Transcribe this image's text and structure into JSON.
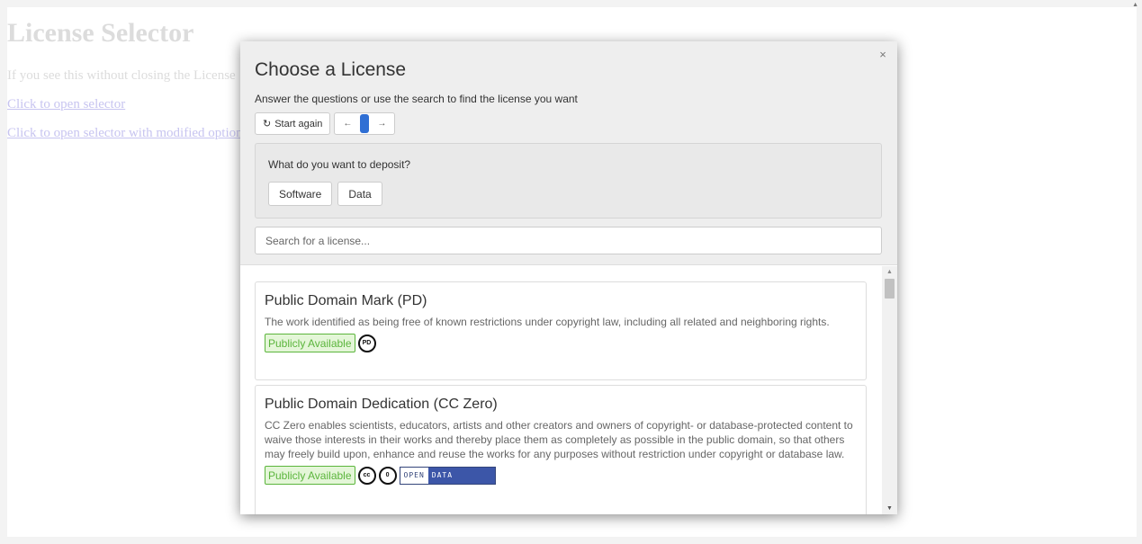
{
  "background": {
    "title": "License Selector",
    "text": "If you see this without closing the License",
    "link1": "Click to open selector",
    "link2": "Click to open selector with modified options"
  },
  "modal": {
    "title": "Choose a License",
    "subtitle": "Answer the questions or use the search to find the license you want",
    "close_symbol": "×",
    "toolbar": {
      "start_again_icon": "↻",
      "start_again_label": "Start again",
      "back_arrow": "←",
      "forward_arrow": "→"
    },
    "question": {
      "text": "What do you want to deposit?",
      "answers": [
        "Software",
        "Data"
      ]
    },
    "search": {
      "placeholder": "Search for a license..."
    },
    "licenses": [
      {
        "title": "Public Domain Mark (PD)",
        "description": "The work identified as being free of known restrictions under copyright law, including all related and neighboring rights.",
        "badge": "Publicly Available",
        "icons": [
          "PD"
        ]
      },
      {
        "title": "Public Domain Dedication (CC Zero)",
        "description": "CC Zero enables scientists, educators, artists and other creators and owners of copyright- or database-protected content to waive those interests in their works and thereby place them as completely as possible in the public domain, so that others may freely build upon, enhance and reuse the works for any purposes without restriction under copyright or database law.",
        "badge": "Publicly Available",
        "icons": [
          "cc",
          "0"
        ],
        "open_data": [
          "OPEN",
          "DATA"
        ]
      }
    ]
  },
  "colors": {
    "accent": "#2f6fd4",
    "badge_green": "#5bb53c",
    "open_data_blue": "#3c56a8"
  }
}
